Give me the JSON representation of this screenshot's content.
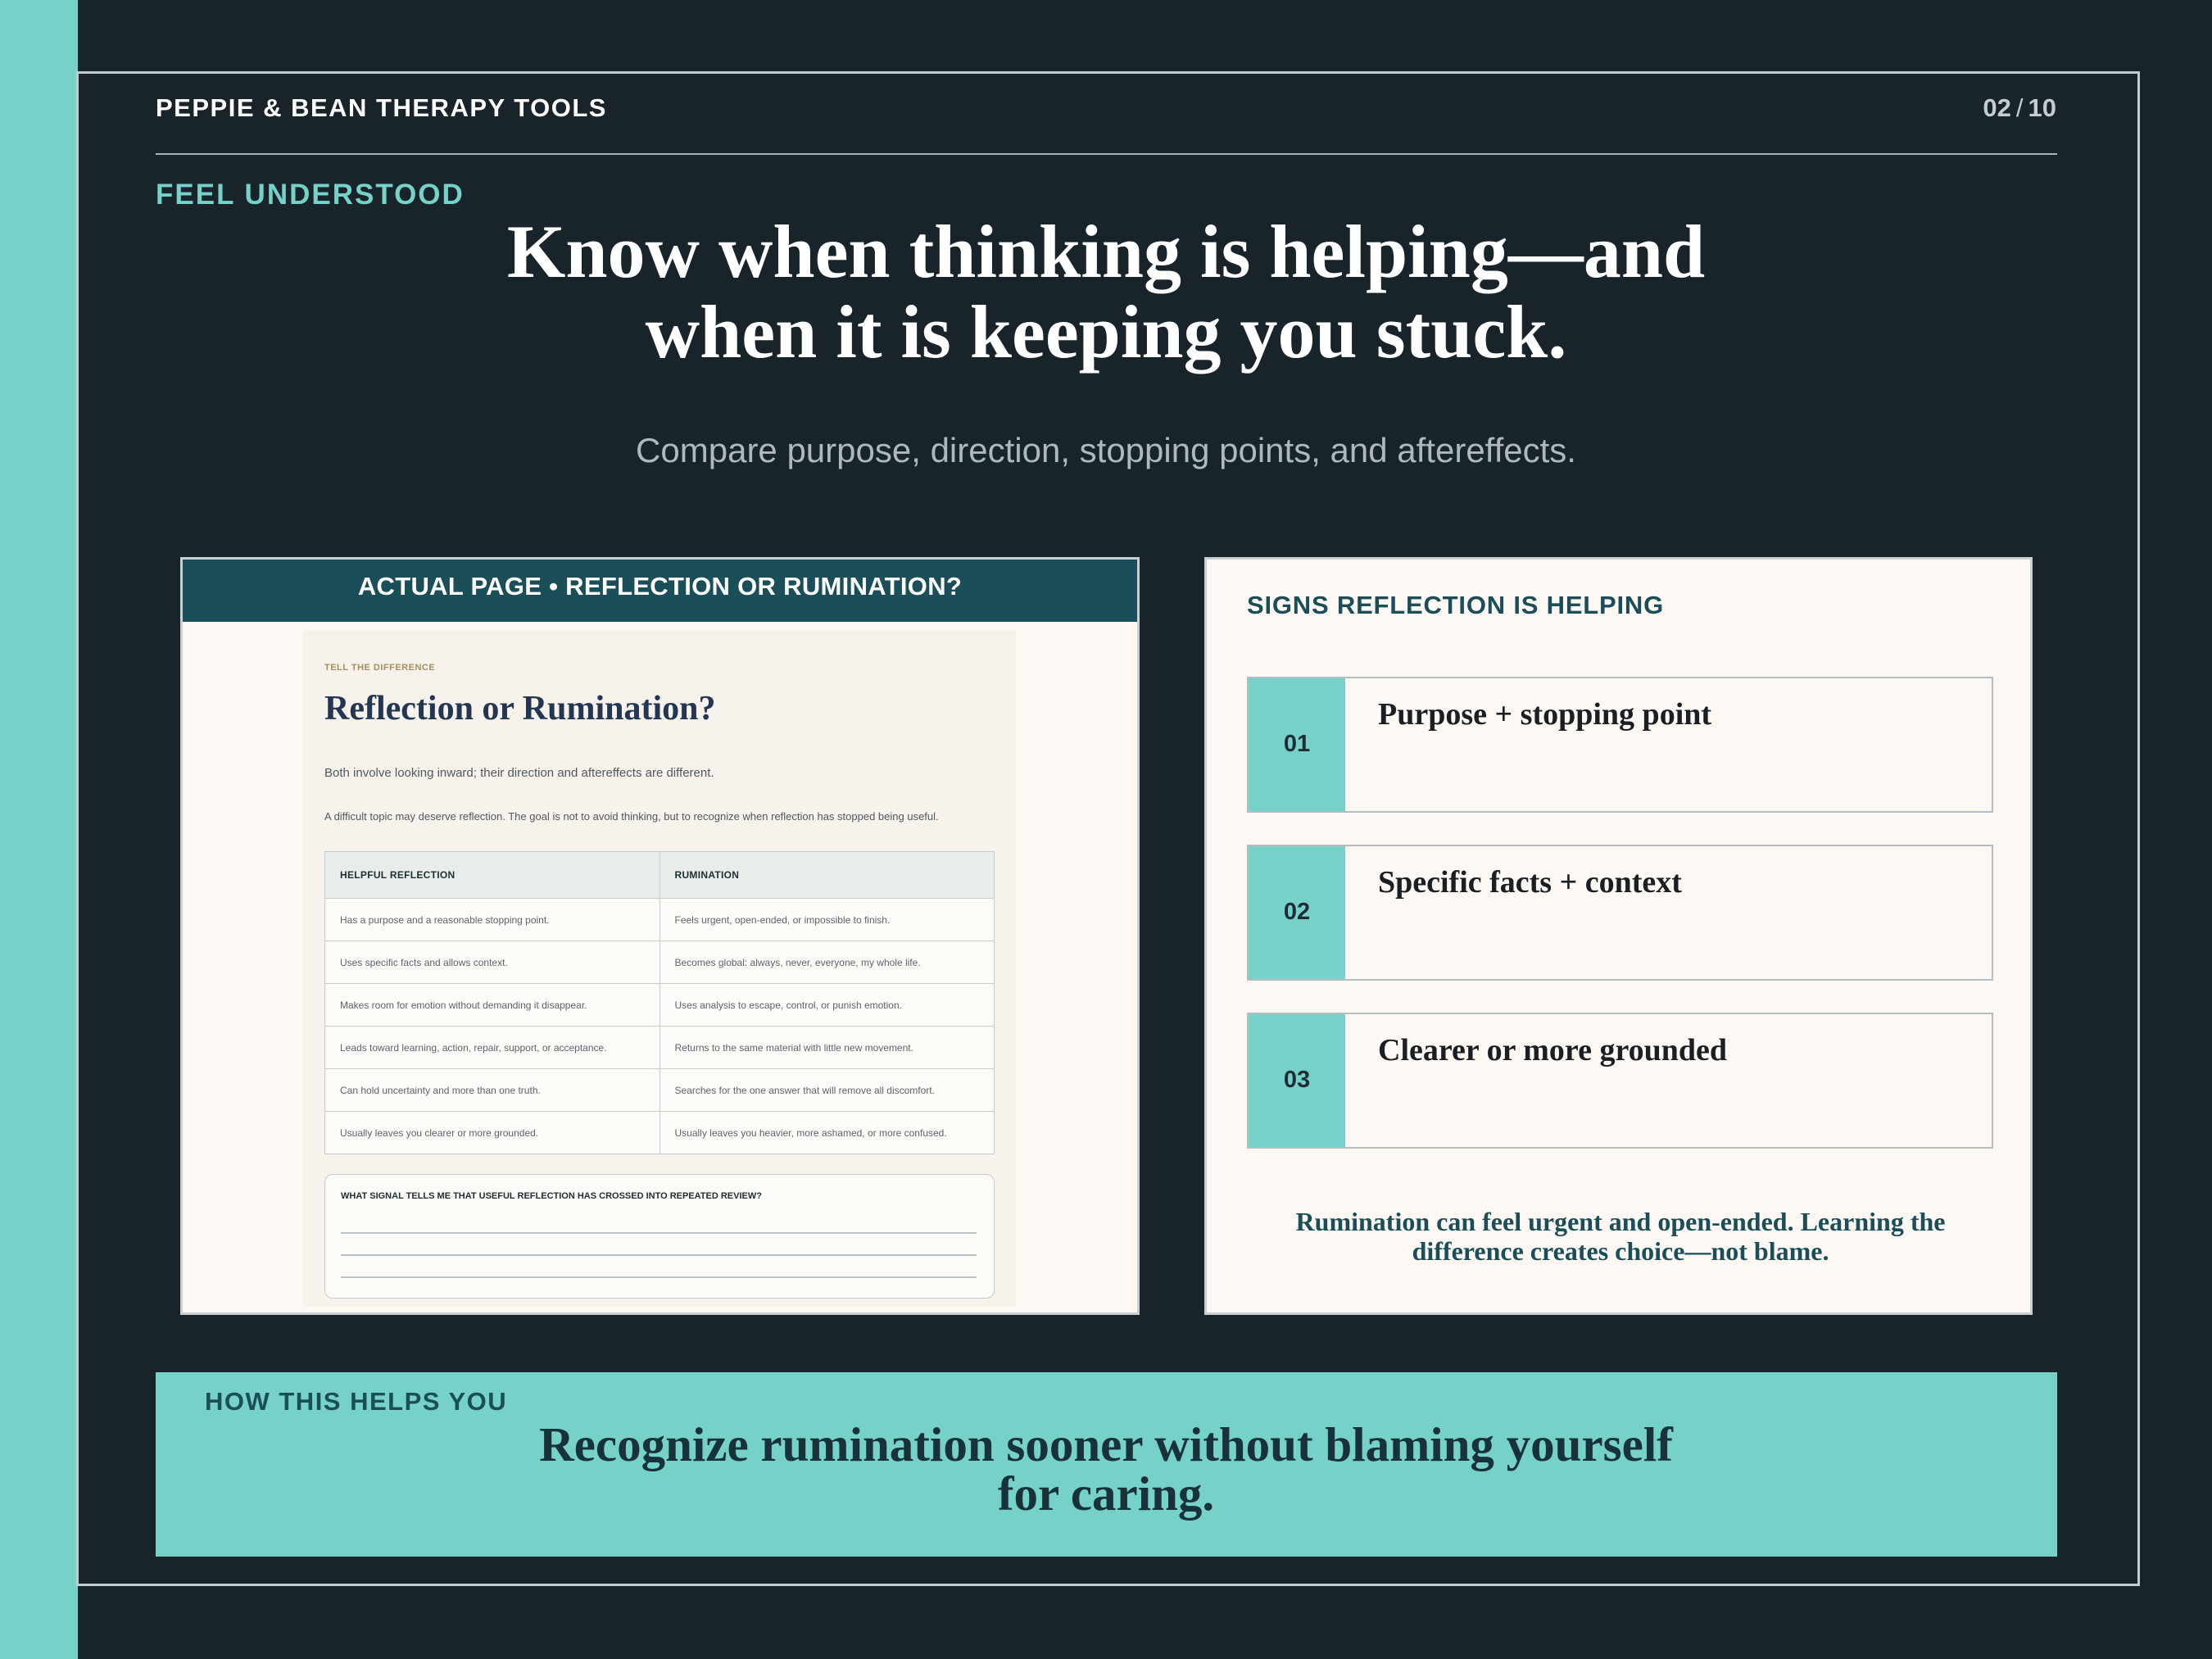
{
  "header": {
    "brand": "PEPPIE & BEAN THERAPY TOOLS",
    "page_current": "02",
    "page_separator": "/",
    "page_total": "10"
  },
  "hero": {
    "kicker": "FEEL UNDERSTOOD",
    "headline_line1": "Know when thinking is helping—and",
    "headline_line2": "when it is keeping you stuck.",
    "subhead": "Compare purpose, direction, stopping points, and aftereffects."
  },
  "preview": {
    "bar_label": "ACTUAL PAGE • REFLECTION OR RUMINATION?",
    "kicker": "TELL THE DIFFERENCE",
    "title": "Reflection or Rumination?",
    "intro": "Both involve looking inward; their direction and aftereffects are different.",
    "note": "A difficult topic may deserve reflection. The goal is not to avoid thinking, but to recognize when reflection has stopped being useful.",
    "table": {
      "headers": [
        "HELPFUL REFLECTION",
        "RUMINATION"
      ],
      "rows": [
        [
          "Has a purpose and a reasonable stopping point.",
          "Feels urgent, open-ended, or impossible to finish."
        ],
        [
          "Uses specific facts and allows context.",
          "Becomes global: always, never, everyone, my whole life."
        ],
        [
          "Makes room for emotion without demanding it disappear.",
          "Uses analysis to escape, control, or punish emotion."
        ],
        [
          "Leads toward learning, action, repair, support, or acceptance.",
          "Returns to the same material with little new movement."
        ],
        [
          "Can hold uncertainty and more than one truth.",
          "Searches for the one answer that will remove all discomfort."
        ],
        [
          "Usually leaves you clearer or more grounded.",
          "Usually leaves you heavier, more ashamed, or more confused."
        ]
      ]
    },
    "prompt": "WHAT SIGNAL TELLS ME THAT USEFUL REFLECTION HAS CROSSED INTO REPEATED REVIEW?"
  },
  "signs": {
    "title": "SIGNS REFLECTION IS HELPING",
    "items": [
      {
        "num": "01",
        "label": "Purpose + stopping point"
      },
      {
        "num": "02",
        "label": "Specific facts + context"
      },
      {
        "num": "03",
        "label": "Clearer or more grounded"
      }
    ],
    "note": "Rumination can feel urgent and open-ended. Learning the difference creates choice—not blame."
  },
  "band": {
    "kicker": "HOW THIS HELPS YOU",
    "text_line1": "Recognize rumination sooner without blaming yourself",
    "text_line2": "for caring."
  },
  "colors": {
    "background": "#18232a",
    "accent_teal": "#76d1c9",
    "deep_teal": "#1a4e58",
    "panel_cream": "#fdf8f4"
  }
}
